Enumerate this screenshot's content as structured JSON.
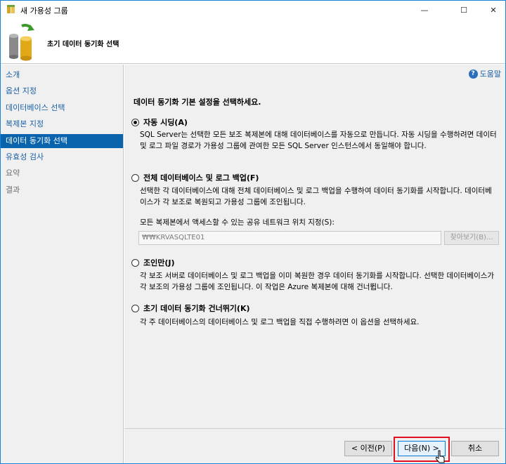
{
  "window": {
    "title": "새 가용성 그룹",
    "minimize_glyph": "—",
    "maximize_glyph": "☐",
    "close_glyph": "✕"
  },
  "header": {
    "title": "초기 데이터 동기화 선택",
    "icon": "database-sync-icon"
  },
  "sidebar": {
    "items": [
      {
        "label": "소개",
        "state": "normal"
      },
      {
        "label": "옵션 지정",
        "state": "normal"
      },
      {
        "label": "데이터베이스 선택",
        "state": "normal"
      },
      {
        "label": "복제본 지정",
        "state": "normal"
      },
      {
        "label": "데이터 동기화 선택",
        "state": "active"
      },
      {
        "label": "유효성 검사",
        "state": "normal"
      },
      {
        "label": "요약",
        "state": "disabled"
      },
      {
        "label": "결과",
        "state": "disabled"
      }
    ]
  },
  "main": {
    "help_label": "도움말",
    "intro": "데이터 동기화 기본 설정을 선택하세요.",
    "options": [
      {
        "label": "자동 시딩(A)",
        "checked": true,
        "description": "SQL Server는 선택한 모든 보조 복제본에 대해 데이터베이스를 자동으로 만듭니다. 자동 시딩을 수행하려면 데이터 및 로그 파일 경로가 가용성 그룹에 관여한 모든 SQL Server 인스턴스에서 동일해야 합니다."
      },
      {
        "label": "전체 데이터베이스 및 로그 백업(F)",
        "checked": false,
        "description": "선택한 각 데이터베이스에 대해 전체 데이터베이스 및 로그 백업을 수행하여 데이터 동기화를 시작합니다. 데이터베이스가 각 보조로 복원되고 가용성 그룹에 조인됩니다."
      },
      {
        "label": "조인만(J)",
        "checked": false,
        "description": "각 보조 서버로 데이터베이스 및 로그 백업을 이미 복원한 경우 데이터 동기화를 시작합니다. 선택한 데이터베이스가 각 보조의 가용성 그룹에 조인됩니다. 이 작업은 Azure 복제본에 대해 건너뜁니다."
      },
      {
        "label": "초기 데이터 동기화 건너뛰기(K)",
        "checked": false,
        "description": "각 주 데이터베이스의 데이터베이스 및 로그 백업을 직접 수행하려면 이 옵션을 선택하세요."
      }
    ],
    "share_label": "모든 복제본에서 액세스할 수 있는 공유 네트워크 위치 지정(S):",
    "share_value": "₩₩KRVASQLTE01",
    "browse_label": "찾아보기(B)..."
  },
  "footer": {
    "prev_label": "< 이전(P)",
    "next_label": "다음(N) >",
    "cancel_label": "취소",
    "highlight_color": "#e01020"
  }
}
